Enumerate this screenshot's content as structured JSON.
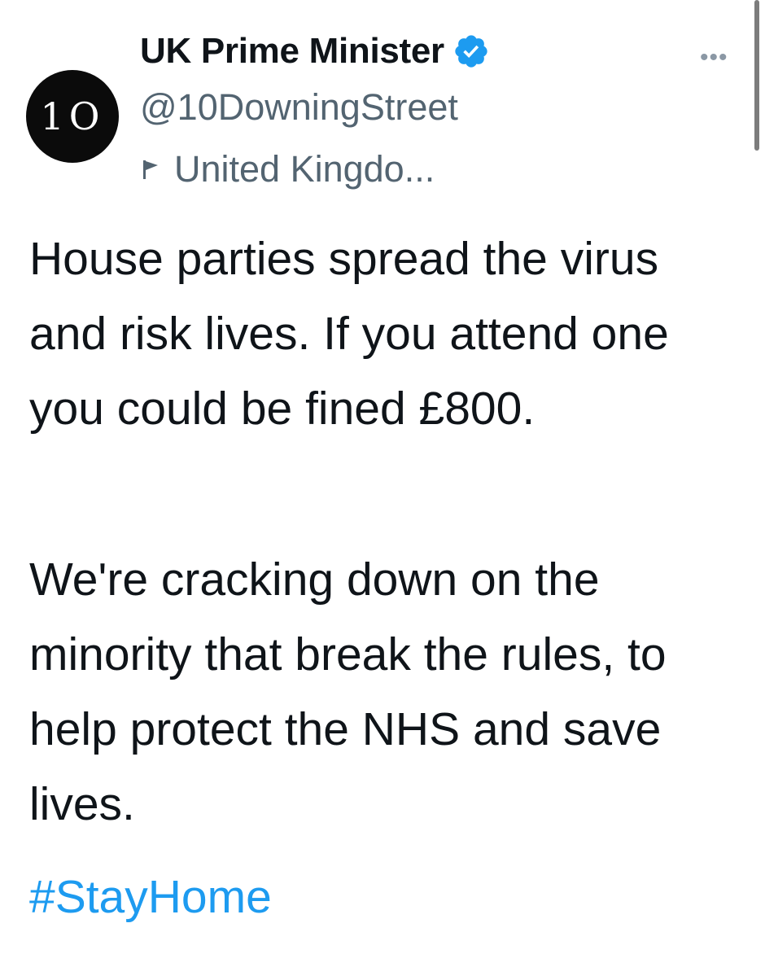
{
  "author": {
    "avatar_text": "1O",
    "display_name": "UK Prime Minister",
    "handle": "@10DowningStreet",
    "location": "United Kingdo...",
    "verified": true
  },
  "menu": {
    "more_label": "•••"
  },
  "tweet": {
    "paragraphs": [
      "House parties spread the virus and risk lives. If you attend one you could be fined £800.",
      "We're cracking down on the minority that break the rules, to help protect the NHS and save lives."
    ],
    "hashtag": "#StayHome"
  },
  "icons": {
    "verified": "verified-badge-icon",
    "location": "flag-icon",
    "more": "more-icon"
  },
  "colors": {
    "accent": "#1d9bf0",
    "secondary_text": "#536471",
    "primary_text": "#0f1419",
    "avatar_bg": "#0b0b0b"
  }
}
